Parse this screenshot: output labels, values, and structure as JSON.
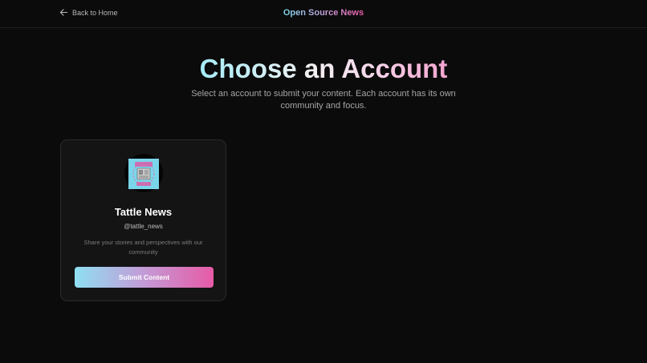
{
  "header": {
    "back_label": "Back to Home",
    "brand": "Open Source News"
  },
  "hero": {
    "title": "Choose an Account",
    "subtitle": "Select an account to submit your content. Each account has its own community and focus."
  },
  "accounts": [
    {
      "name": "Tattle News",
      "handle": "@tattle_news",
      "description": "Share your stories and perspectives with our community",
      "button_label": "Submit Content",
      "avatar_text": "TATTLE NEWS"
    }
  ],
  "colors": {
    "background": "#0b0b0b",
    "card": "#141414",
    "accent_start": "#8fdff2",
    "accent_end": "#e75aa6"
  }
}
